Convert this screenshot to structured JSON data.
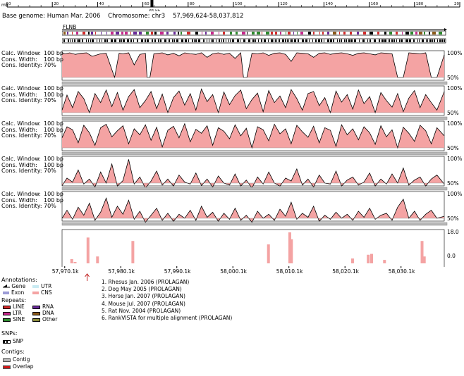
{
  "header": {
    "base_genome_label": "Base genome:",
    "base_genome": "Human Mar. 2006",
    "chromosome_label": "Chromosome:",
    "chromosome": "chr3",
    "range": "57,969,624-58,037,812",
    "ruler_unit": "mb",
    "cursor_label": "65 kb"
  },
  "top_ruler": {
    "ticks": [
      {
        "label": "0",
        "value": 0
      },
      {
        "label": "20",
        "value": 20
      },
      {
        "label": "40",
        "value": 40
      },
      {
        "label": "60",
        "value": 60
      },
      {
        "label": "80",
        "value": 80
      },
      {
        "label": "100",
        "value": 100
      },
      {
        "label": "120",
        "value": 120
      },
      {
        "label": "140",
        "value": 140
      },
      {
        "label": "160",
        "value": 160
      },
      {
        "label": "180",
        "value": 180
      },
      {
        "label": "20",
        "value": 200
      }
    ],
    "max": 200,
    "highlight_value": 64
  },
  "gene_track": {
    "gene_name": "FLNB"
  },
  "track_labels": {
    "calc_window": "Calc. Window:",
    "calc_window_value": "100 bp",
    "cons_width": "Cons. Width:",
    "cons_width_value": "100 bp",
    "cons_identity": "Cons. Identity:",
    "cons_identity_value": "70%"
  },
  "percent_labels": {
    "top": "100%",
    "bottom": "50%"
  },
  "rankvista_labels": {
    "top": "18.0",
    "bottom": "0.0"
  },
  "colors": {
    "conserved_fill": "#f4a3a3",
    "conserved_line": "#000000",
    "cns": "#f4a3a3",
    "exon": "#9b9bd6",
    "utr": "#c8eaf2",
    "line": "#d42a2a",
    "ltr": "#c8288c",
    "sine": "#2e8a2e",
    "rna": "#6a2a9a",
    "dna": "#8b5a1a",
    "other": "#8a8a3a",
    "contig": "#b8b8b8",
    "overlap": "#d01818"
  },
  "chart_data": [
    {
      "type": "area",
      "track": 1,
      "title": "1. Rhesus Jan. 2006 (PROLAGAN)",
      "ylim": [
        50,
        100
      ],
      "xlim": [
        57969624,
        58037812
      ],
      "x": [
        57969624,
        57970200,
        57971000,
        57972000,
        57973000,
        57974000,
        57975000,
        57976500,
        57977500,
        57979000,
        57979800,
        57980500,
        57981500,
        57982500,
        57983500,
        57984500,
        57984800,
        57985300,
        57986000,
        57987500,
        57988500,
        57989500,
        57990500,
        57991500,
        57992500,
        57993500,
        57994500,
        57995500,
        57996500,
        57997500,
        57998500,
        57999500,
        58000500,
        58001500,
        58002000,
        58002600,
        58003500,
        58004500,
        58005500,
        58006500,
        58007500,
        58008500,
        58009500,
        58010500,
        58011500,
        58012500,
        58013500,
        58014500,
        58015500,
        58016500,
        58017500,
        58018500,
        58019500,
        58020500,
        58021500,
        58022500,
        58023500,
        58024500,
        58025500,
        58026500,
        58027500,
        58028500,
        58029500,
        58030500,
        58031500,
        58032500,
        58033500,
        58034500,
        58035500,
        58036500,
        58037812
      ],
      "y": [
        98,
        97,
        99,
        96,
        98,
        99,
        92,
        97,
        98,
        50,
        98,
        97,
        99,
        75,
        96,
        98,
        50,
        50,
        97,
        99,
        95,
        98,
        93,
        99,
        97,
        96,
        99,
        90,
        97,
        99,
        96,
        98,
        88,
        99,
        50,
        50,
        98,
        97,
        99,
        94,
        98,
        99,
        96,
        82,
        99,
        98,
        97,
        90,
        98,
        99,
        96,
        98,
        99,
        97,
        94,
        98,
        99,
        97,
        95,
        99,
        98,
        97,
        50,
        50,
        99,
        98,
        97,
        99,
        50,
        50,
        95
      ]
    },
    {
      "type": "area",
      "track": 2,
      "title": "2. Dog May 2005 (PROLAGAN)",
      "ylim": [
        50,
        100
      ],
      "xlim": [
        57969624,
        58037812
      ],
      "x": [
        57969624,
        57970500,
        57971500,
        57972500,
        57973500,
        57974500,
        57975500,
        57976500,
        57977500,
        57978500,
        57979500,
        57980500,
        57981500,
        57982500,
        57983500,
        57984500,
        57985500,
        57986500,
        57987500,
        57988500,
        57989500,
        57990500,
        57991500,
        57992500,
        57993500,
        57994500,
        57995500,
        57996500,
        57997500,
        57998500,
        57999500,
        58000500,
        58001500,
        58002500,
        58003500,
        58004500,
        58005500,
        58006500,
        58007500,
        58008500,
        58009500,
        58010500,
        58011500,
        58012500,
        58013500,
        58014500,
        58015500,
        58016500,
        58017500,
        58018500,
        58019500,
        58020500,
        58021500,
        58022500,
        58023500,
        58024500,
        58025500,
        58026500,
        58027500,
        58028500,
        58029500,
        58030500,
        58031500,
        58032500,
        58033500,
        58034500,
        58035500,
        58036500,
        58037812
      ],
      "y": [
        55,
        85,
        60,
        92,
        78,
        50,
        88,
        70,
        95,
        62,
        90,
        55,
        82,
        96,
        60,
        74,
        92,
        58,
        87,
        50,
        80,
        93,
        65,
        88,
        55,
        97,
        72,
        86,
        50,
        91,
        66,
        84,
        95,
        58,
        76,
        89,
        52,
        94,
        70,
        83,
        60,
        96,
        78,
        55,
        88,
        92,
        64,
        80,
        50,
        93,
        71,
        86,
        57,
        95,
        68,
        82,
        50,
        90,
        74,
        61,
        88,
        52,
        79,
        94,
        60,
        86,
        70,
        55,
        92
      ]
    },
    {
      "type": "area",
      "track": 3,
      "title": "3. Horse Jan. 2007 (PROLAGAN)",
      "ylim": [
        50,
        100
      ],
      "xlim": [
        57969624,
        58037812
      ],
      "x": [
        57969624,
        57970500,
        57971500,
        57972500,
        57973500,
        57974500,
        57975500,
        57976500,
        57977500,
        57978500,
        57979500,
        57980500,
        57981500,
        57982500,
        57983500,
        57984500,
        57985500,
        57986500,
        57987500,
        57988500,
        57989500,
        57990500,
        57991500,
        57992500,
        57993500,
        57994500,
        57995500,
        57996500,
        57997500,
        57998500,
        57999500,
        58000500,
        58001500,
        58002500,
        58003500,
        58004500,
        58005500,
        58006500,
        58007500,
        58008500,
        58009500,
        58010500,
        58011500,
        58012500,
        58013500,
        58014500,
        58015500,
        58016500,
        58017500,
        58018500,
        58019500,
        58020500,
        58021500,
        58022500,
        58023500,
        58024500,
        58025500,
        58026500,
        58027500,
        58028500,
        58029500,
        58030500,
        58031500,
        58032500,
        58033500,
        58034500,
        58035500,
        58036500,
        58037812
      ],
      "y": [
        70,
        92,
        86,
        60,
        95,
        80,
        55,
        90,
        97,
        72,
        84,
        94,
        58,
        88,
        76,
        96,
        65,
        91,
        52,
        85,
        93,
        70,
        98,
        62,
        87,
        79,
        94,
        55,
        90,
        83,
        68,
        96,
        74,
        89,
        50,
        92,
        86,
        64,
        97,
        78,
        88,
        58,
        95,
        82,
        71,
        93,
        60,
        90,
        85,
        53,
        96,
        76,
        88,
        66,
        92,
        80,
        57,
        94,
        72,
        86,
        50,
        91,
        79,
        63,
        95,
        84,
        58,
        90,
        74
      ]
    },
    {
      "type": "area",
      "track": 4,
      "title": "4. Mouse Jul. 2007 (PROLAGAN)",
      "ylim": [
        50,
        100
      ],
      "xlim": [
        57969624,
        58037812
      ],
      "x": [
        57969624,
        57970500,
        57971500,
        57972500,
        57973500,
        57974500,
        57975500,
        57976500,
        57977500,
        57978500,
        57979500,
        57980500,
        57981500,
        57982500,
        57983500,
        57984500,
        57985500,
        57986500,
        57987500,
        57988500,
        57989500,
        57990500,
        57991500,
        57992500,
        57993500,
        57994500,
        57995500,
        57996500,
        57997500,
        57998500,
        57999500,
        58000500,
        58001500,
        58002500,
        58003500,
        58004500,
        58005500,
        58006500,
        58007500,
        58008500,
        58009500,
        58010500,
        58011500,
        58012500,
        58013500,
        58014500,
        58015500,
        58016500,
        58017500,
        58018500,
        58019500,
        58020500,
        58021500,
        58022500,
        58023500,
        58024500,
        58025500,
        58026500,
        58027500,
        58028500,
        58029500,
        58030500,
        58031500,
        58032500,
        58033500,
        58034500,
        58035500,
        58036500,
        58037812
      ],
      "y": [
        45,
        60,
        52,
        76,
        48,
        58,
        42,
        72,
        50,
        88,
        44,
        55,
        97,
        48,
        62,
        40,
        54,
        74,
        46,
        58,
        44,
        66,
        52,
        48,
        70,
        45,
        58,
        42,
        64,
        50,
        46,
        68,
        44,
        56,
        40,
        62,
        48,
        72,
        50,
        44,
        60,
        54,
        78,
        46,
        58,
        42,
        66,
        50,
        48,
        74,
        44,
        56,
        62,
        46,
        52,
        70,
        44,
        58,
        48,
        68,
        50,
        80,
        46,
        56,
        62,
        44,
        58,
        66,
        48
      ]
    },
    {
      "type": "area",
      "track": 5,
      "title": "5. Rat Nov. 2004 (PROLAGAN)",
      "ylim": [
        50,
        100
      ],
      "xlim": [
        57969624,
        58037812
      ],
      "x": [
        57969624,
        57970500,
        57971500,
        57972500,
        57973500,
        57974500,
        57975500,
        57976500,
        57977500,
        57978500,
        57979500,
        57980500,
        57981500,
        57982500,
        57983500,
        57984500,
        57985500,
        57986500,
        57987500,
        57988500,
        57989500,
        57990500,
        57991500,
        57992500,
        57993500,
        57994500,
        57995500,
        57996500,
        57997500,
        57998500,
        57999500,
        58000500,
        58001500,
        58002500,
        58003500,
        58004500,
        58005500,
        58006500,
        58007500,
        58008500,
        58009500,
        58010500,
        58011500,
        58012500,
        58013500,
        58014500,
        58015500,
        58016500,
        58017500,
        58018500,
        58019500,
        58020500,
        58021500,
        58022500,
        58023500,
        58024500,
        58025500,
        58026500,
        58027500,
        58028500,
        58029500,
        58030500,
        58031500,
        58032500,
        58033500,
        58034500,
        58035500,
        58036500,
        58037812
      ],
      "y": [
        50,
        66,
        48,
        72,
        56,
        80,
        46,
        62,
        90,
        52,
        74,
        58,
        86,
        48,
        64,
        42,
        56,
        70,
        46,
        60,
        44,
        58,
        50,
        66,
        46,
        74,
        52,
        62,
        44,
        60,
        48,
        70,
        46,
        56,
        42,
        64,
        50,
        58,
        46,
        68,
        54,
        82,
        48,
        60,
        52,
        74,
        44,
        56,
        48,
        62,
        50,
        58,
        46,
        64,
        52,
        70,
        48,
        56,
        60,
        46,
        72,
        88,
        50,
        64,
        46,
        58,
        66,
        50,
        54
      ]
    },
    {
      "type": "bar",
      "track": 6,
      "title": "6. RankVISTA for multiple alignment (PROLAGAN)",
      "ylim": [
        0,
        18
      ],
      "x": [
        57971100,
        57971700,
        57974000,
        57975700,
        57982000,
        58006200,
        58010000,
        58010300,
        58021200,
        58024000,
        58024600,
        58026900,
        58033600,
        58034000
      ],
      "values": [
        2.5,
        0.8,
        15,
        4,
        13,
        11,
        18,
        14,
        2.8,
        5,
        5.5,
        2,
        13,
        4
      ]
    }
  ],
  "bottom_axis": {
    "ticks": [
      {
        "label": "57,970.1k",
        "value": 57970100
      },
      {
        "label": "57,980.1k",
        "value": 57980100
      },
      {
        "label": "57,990.1k",
        "value": 57990100
      },
      {
        "label": "58,000.1k",
        "value": 58000100
      },
      {
        "label": "58,010.1k",
        "value": 58010100
      },
      {
        "label": "58,020.1k",
        "value": 58020100
      },
      {
        "label": "58,030.1k",
        "value": 58030100
      }
    ],
    "marker_value": 57974100
  },
  "track_titles": [
    "1. Rhesus Jan. 2006 (PROLAGAN)",
    "2. Dog May 2005 (PROLAGAN)",
    "3. Horse Jan. 2007 (PROLAGAN)",
    "4. Mouse Jul. 2007 (PROLAGAN)",
    "5. Rat Nov. 2004 (PROLAGAN)",
    "6. RankVISTA for multiple alignment (PROLAGAN)"
  ],
  "legend": {
    "annotations_title": "Annotations:",
    "annotations": [
      {
        "label": "Gene",
        "icon": "gene-arrow-icon"
      },
      {
        "label": "UTR",
        "icon": "utr-swatch"
      },
      {
        "label": "Exon",
        "icon": "exon-swatch"
      },
      {
        "label": "CNS",
        "icon": "cns-swatch"
      }
    ],
    "repeats_title": "Repeats:",
    "repeats": [
      {
        "label": "LINE",
        "color": "#d42a2a"
      },
      {
        "label": "RNA",
        "color": "#6a2a9a"
      },
      {
        "label": "LTR",
        "color": "#c8288c"
      },
      {
        "label": "DNA",
        "color": "#8b5a1a"
      },
      {
        "label": "SINE",
        "color": "#2e8a2e"
      },
      {
        "label": "Other",
        "color": "#8a8a3a"
      }
    ],
    "snps_title": "SNPs:",
    "snp_label": "SNP",
    "contigs_title": "Contigs:",
    "contig_label": "Contig",
    "overlap_label": "Overlap"
  }
}
